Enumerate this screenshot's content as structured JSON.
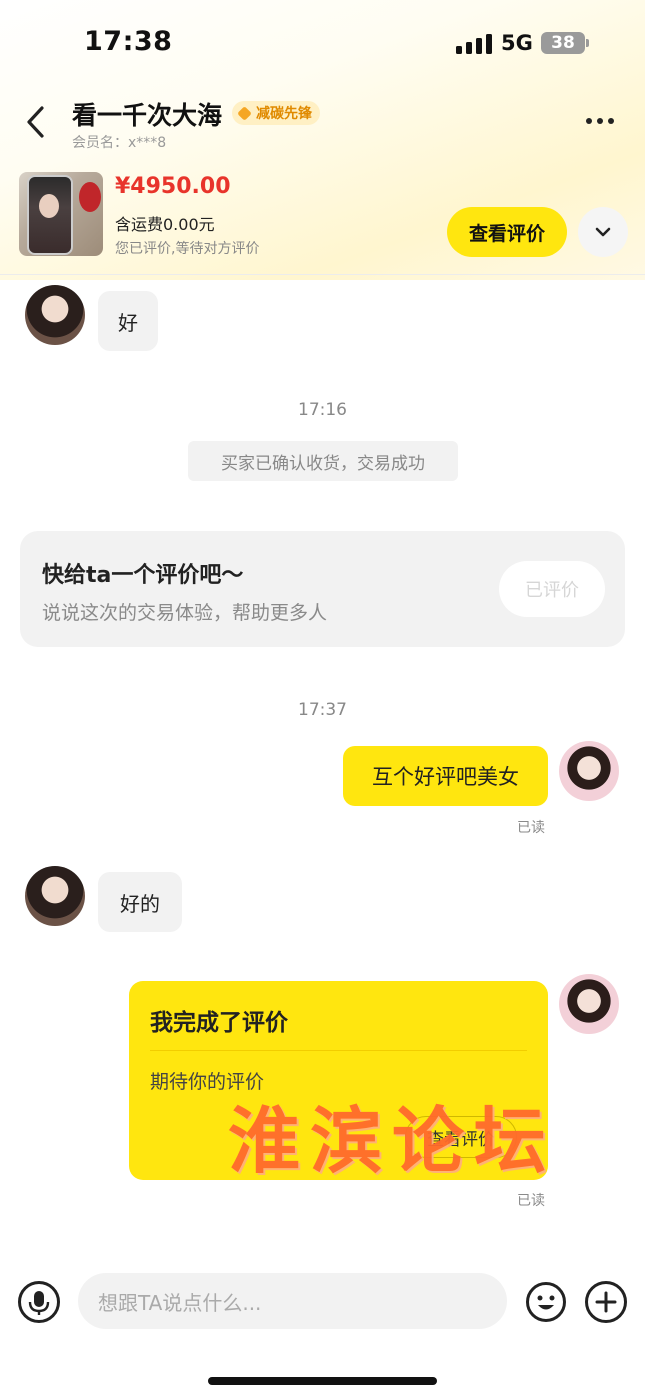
{
  "status_bar": {
    "time": "17:38",
    "network": "5G",
    "battery": "38"
  },
  "header": {
    "title": "看一千次大海",
    "badge": "减碳先锋",
    "member_label": "会员名：",
    "member_name": "x***8"
  },
  "product": {
    "price": "¥4950.00",
    "shipping": "含运费0.00元",
    "status": "您已评价,等待对方评价",
    "review_button": "查看评价"
  },
  "messages": {
    "msg1": "好",
    "time1": "17:16",
    "system": "买家已确认收货，交易成功",
    "card_title": "快给ta一个评价吧～",
    "card_sub": "说说这次的交易体验，帮助更多人",
    "card_button": "已评价",
    "time2": "17:37",
    "msg2": "互个好评吧美女",
    "read1": "已读",
    "msg3": "好的",
    "ycard_title": "我完成了评价",
    "ycard_sub": "期待你的评价",
    "ycard_button": "查看评价",
    "read2": "已读"
  },
  "watermark": "淮滨论坛",
  "input": {
    "placeholder": "想跟TA说点什么..."
  },
  "colors": {
    "accent": "#ffe60f",
    "price": "#e8342b",
    "badge": "#e08a00"
  }
}
